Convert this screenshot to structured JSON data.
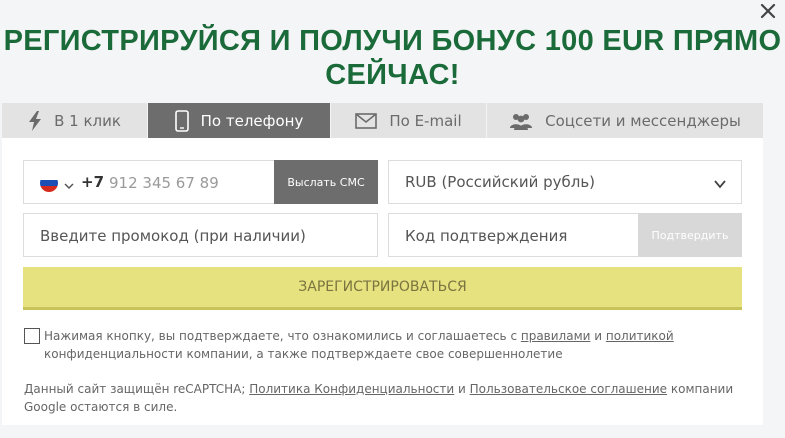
{
  "headline": {
    "line1": "РЕГИСТРИРУЙСЯ И ПОЛУЧИ БОНУС 100 EUR ПРЯМО",
    "line2": "СЕЙЧАС!"
  },
  "tabs": [
    {
      "label": "В 1 клик",
      "icon": "lightning-icon"
    },
    {
      "label": "По телефону",
      "icon": "phone-icon",
      "active": true
    },
    {
      "label": "По E-mail",
      "icon": "envelope-icon"
    },
    {
      "label": "Соцсети и мессенджеры",
      "icon": "users-icon"
    }
  ],
  "phone": {
    "prefix": "+7",
    "placeholder": "912 345 67 89",
    "send_sms_label": "Выслать СМС",
    "country_flag": "russia-flag-icon"
  },
  "currency": {
    "selected": "RUB (Российский рубль)"
  },
  "promo": {
    "placeholder": "Введите промокод (при наличии)"
  },
  "code": {
    "placeholder": "Код подтверждения",
    "confirm_label": "Подтвердить"
  },
  "register": {
    "label": "ЗАРЕГИСТРИРОВАТЬСЯ"
  },
  "terms": {
    "text1": "Нажимая кнопку, вы подтверждаете, что ознакомились и соглашаетесь с ",
    "link_rules": "правилами",
    "and": " и ",
    "link_policy": "политикой",
    "text2": " конфиденциальности компании, а также подтверждаете свое совершеннолетие"
  },
  "recaptcha": {
    "text1": "Данный сайт защищён reCAPTCHA; ",
    "link_privacy": "Политика Конфиденциальности",
    "and": " и ",
    "link_terms": "Пользовательское соглашение",
    "text2": " компании Google остаются в силе."
  },
  "colors": {
    "headline": "#1b6b3a",
    "register_bg": "#e6e27f",
    "active_tab": "#6d6d6d"
  }
}
